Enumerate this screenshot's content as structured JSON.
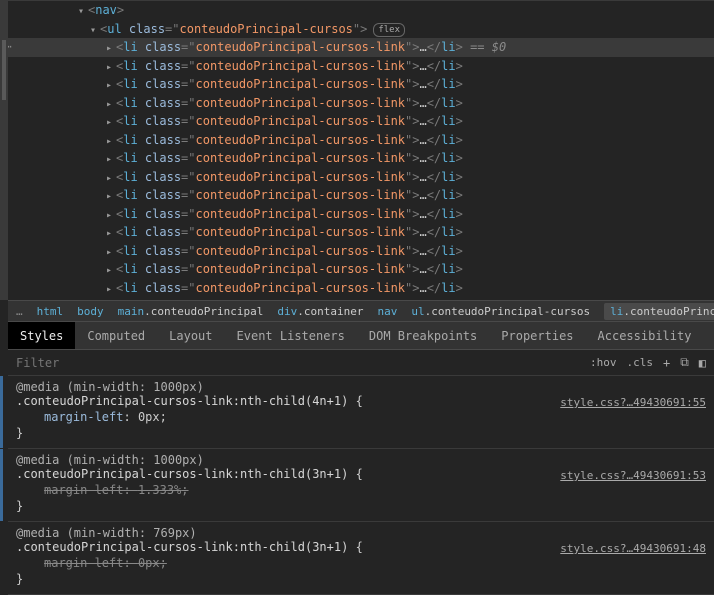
{
  "dom": {
    "nav_open": "<nav>",
    "ul_tag": "ul",
    "ul_class": "conteudoPrincipal-cursos",
    "flex_badge": "flex",
    "li_tag": "li",
    "li_class": "conteudoPrincipal-cursos-link",
    "ellipsis": "…",
    "sel_hint": "== $0",
    "close_li": "</li>"
  },
  "crumbs": [
    {
      "tag": "…",
      "cls": "",
      "type": "ell"
    },
    {
      "tag": "html",
      "cls": ""
    },
    {
      "tag": "body",
      "cls": ""
    },
    {
      "tag": "main",
      "cls": ".conteudoPrincipal"
    },
    {
      "tag": "div",
      "cls": ".container"
    },
    {
      "tag": "nav",
      "cls": ""
    },
    {
      "tag": "ul",
      "cls": ".conteudoPrincipal-cursos"
    },
    {
      "tag": "li",
      "cls": ".conteudoPrinc",
      "type": "sel"
    }
  ],
  "tabs": [
    "Styles",
    "Computed",
    "Layout",
    "Event Listeners",
    "DOM Breakpoints",
    "Properties",
    "Accessibility"
  ],
  "filter": {
    "placeholder": "Filter",
    "hov": ":hov",
    "cls": ".cls"
  },
  "rules": [
    {
      "media": "@media (min-width: 1000px)",
      "selector": ".conteudoPrincipal-cursos-link:nth-child(4n+1)",
      "props": [
        {
          "name": "margin-left",
          "value": "0px",
          "strike": false
        }
      ],
      "src": "style.css?…49430691:55",
      "marker": true
    },
    {
      "media": "@media (min-width: 1000px)",
      "selector": ".conteudoPrincipal-cursos-link:nth-child(3n+1)",
      "props": [
        {
          "name": "margin-left",
          "value": "1.333%",
          "strike": true
        }
      ],
      "src": "style.css?…49430691:53",
      "marker": true
    },
    {
      "media": "@media (min-width: 769px)",
      "selector": ".conteudoPrincipal-cursos-link:nth-child(3n+1)",
      "props": [
        {
          "name": "margin-left",
          "value": "0px",
          "strike": true
        }
      ],
      "src": "style.css?…49430691:48",
      "marker": false
    }
  ]
}
